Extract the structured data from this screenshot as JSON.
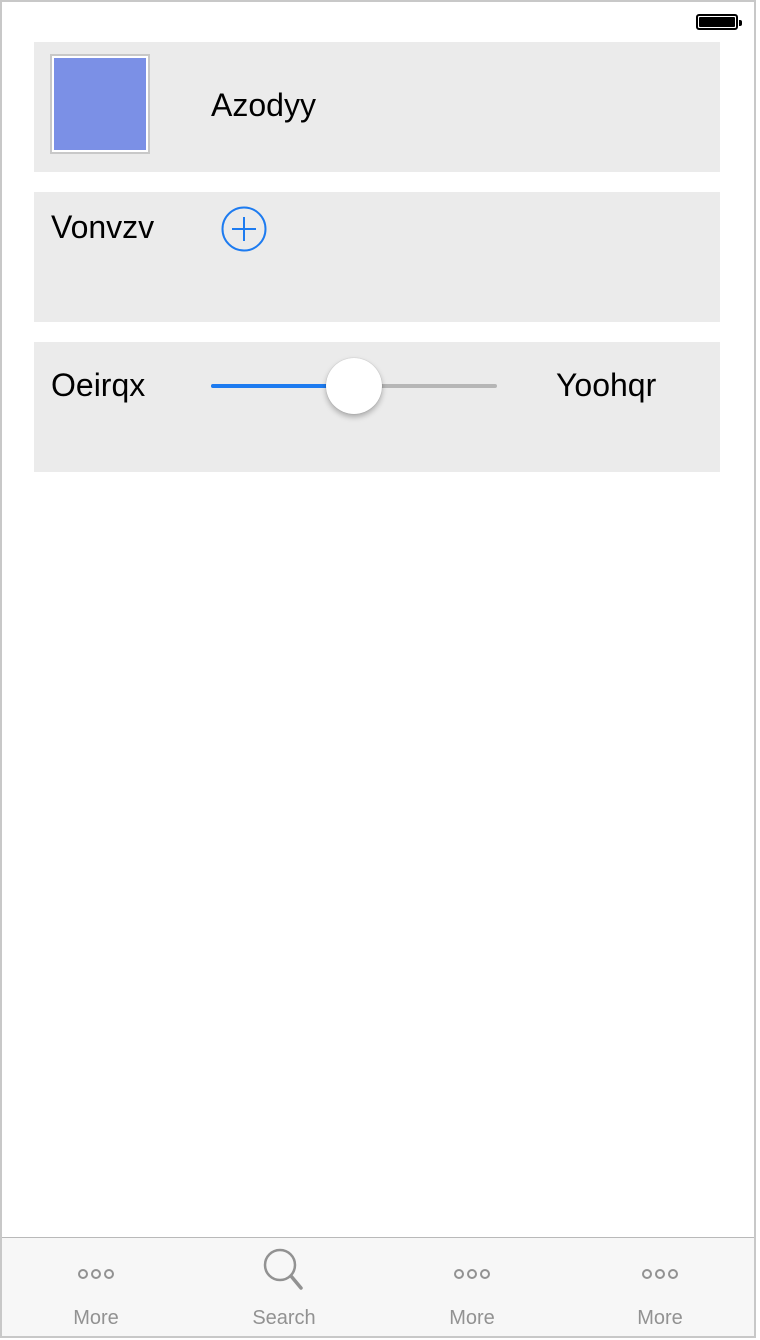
{
  "status_bar": {
    "battery_icon": "battery-full-icon"
  },
  "row_1": {
    "swatch_color": "#7b90e6",
    "label": "Azodyy"
  },
  "row_2": {
    "label": "Vonvzv",
    "add_icon": "plus-circle-icon",
    "accent": "#1d7bf0"
  },
  "row_3": {
    "left_label": "Oeirqx",
    "right_label": "Yoohqr",
    "slider_value": 0.5
  },
  "tab_bar": {
    "items": [
      {
        "label": "More",
        "icon": "more-icon"
      },
      {
        "label": "Search",
        "icon": "search-icon"
      },
      {
        "label": "More",
        "icon": "more-icon"
      },
      {
        "label": "More",
        "icon": "more-icon"
      }
    ]
  }
}
